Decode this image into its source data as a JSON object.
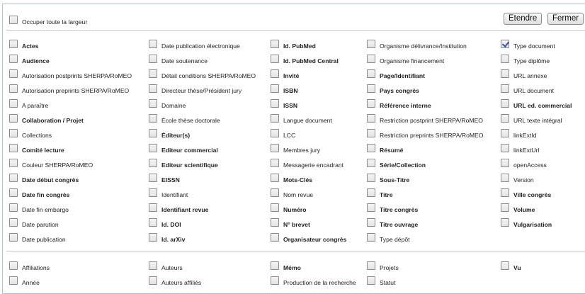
{
  "top": {
    "full_width_label": "Occuper toute la largeur",
    "expand_label": "Etendre",
    "close_label": "Fermer"
  },
  "fields": [
    [
      {
        "label": "Actes",
        "bold": true,
        "checked": false
      },
      {
        "label": "Audience",
        "bold": true,
        "checked": false
      },
      {
        "label": "Autorisation postprints SHERPA/RoMEO",
        "bold": false,
        "checked": false
      },
      {
        "label": "Autorisation preprints SHERPA/RoMEO",
        "bold": false,
        "checked": false
      },
      {
        "label": "A paraître",
        "bold": false,
        "checked": false
      },
      {
        "label": "Collaboration / Projet",
        "bold": true,
        "checked": false
      },
      {
        "label": "Collections",
        "bold": false,
        "checked": false
      },
      {
        "label": "Comité lecture",
        "bold": true,
        "checked": false
      },
      {
        "label": "Couleur SHERPA/RoMEO",
        "bold": false,
        "checked": false
      },
      {
        "label": "Date début congrès",
        "bold": true,
        "checked": false
      },
      {
        "label": "Date fin congrès",
        "bold": true,
        "checked": false
      },
      {
        "label": "Date fin embargo",
        "bold": false,
        "checked": false
      },
      {
        "label": "Date parution",
        "bold": false,
        "checked": false
      },
      {
        "label": "Date publication",
        "bold": false,
        "checked": false
      }
    ],
    [
      {
        "label": "Date publication électronique",
        "bold": false,
        "checked": false
      },
      {
        "label": "Date soutenance",
        "bold": false,
        "checked": false
      },
      {
        "label": "Détail conditions SHERPA/RoMEO",
        "bold": false,
        "checked": false
      },
      {
        "label": "Directeur thèse/Président jury",
        "bold": false,
        "checked": false
      },
      {
        "label": "Domaine",
        "bold": false,
        "checked": false
      },
      {
        "label": "École thèse doctorale",
        "bold": false,
        "checked": false
      },
      {
        "label": "Éditeur(s)",
        "bold": true,
        "checked": false
      },
      {
        "label": "Editeur commercial",
        "bold": true,
        "checked": false
      },
      {
        "label": "Editeur scientifique",
        "bold": true,
        "checked": false
      },
      {
        "label": "EISSN",
        "bold": true,
        "checked": false
      },
      {
        "label": "Identifiant",
        "bold": false,
        "checked": false
      },
      {
        "label": "Identifiant revue",
        "bold": true,
        "checked": false
      },
      {
        "label": "Id. DOI",
        "bold": true,
        "checked": false
      },
      {
        "label": "Id. arXiv",
        "bold": true,
        "checked": false
      }
    ],
    [
      {
        "label": "Id. PubMed",
        "bold": true,
        "checked": false
      },
      {
        "label": "Id. PubMed Central",
        "bold": true,
        "checked": false
      },
      {
        "label": "Invité",
        "bold": true,
        "checked": false
      },
      {
        "label": "ISBN",
        "bold": true,
        "checked": false
      },
      {
        "label": "ISSN",
        "bold": true,
        "checked": false
      },
      {
        "label": "Langue document",
        "bold": false,
        "checked": false
      },
      {
        "label": "LCC",
        "bold": false,
        "checked": false
      },
      {
        "label": "Membres jury",
        "bold": false,
        "checked": false
      },
      {
        "label": "Messagerie encadrant",
        "bold": false,
        "checked": false
      },
      {
        "label": "Mots-Clés",
        "bold": true,
        "checked": false
      },
      {
        "label": "Nom revue",
        "bold": false,
        "checked": false
      },
      {
        "label": "Numéro",
        "bold": true,
        "checked": false
      },
      {
        "label": "N° brevet",
        "bold": true,
        "checked": false
      },
      {
        "label": "Organisateur congrès",
        "bold": true,
        "checked": false
      }
    ],
    [
      {
        "label": "Organisme délivrance/Institution",
        "bold": false,
        "checked": false
      },
      {
        "label": "Organisme financement",
        "bold": false,
        "checked": false
      },
      {
        "label": "Page/Identifiant",
        "bold": true,
        "checked": false
      },
      {
        "label": "Pays congrès",
        "bold": true,
        "checked": false
      },
      {
        "label": "Référence interne",
        "bold": true,
        "checked": false
      },
      {
        "label": "Restriction postprint SHERPA/RoMEO",
        "bold": false,
        "checked": false
      },
      {
        "label": "Restriction preprints SHERPA/RoMEO",
        "bold": false,
        "checked": false
      },
      {
        "label": "Résumé",
        "bold": true,
        "checked": false
      },
      {
        "label": "Série/Collection",
        "bold": true,
        "checked": false
      },
      {
        "label": "Sous-Titre",
        "bold": true,
        "checked": false
      },
      {
        "label": "Titre",
        "bold": true,
        "checked": false
      },
      {
        "label": "Titre congrès",
        "bold": true,
        "checked": false
      },
      {
        "label": "Titre ouvrage",
        "bold": true,
        "checked": false
      },
      {
        "label": "Type dépôt",
        "bold": false,
        "checked": false
      }
    ],
    [
      {
        "label": "Type document",
        "bold": false,
        "checked": true
      },
      {
        "label": "Type diplôme",
        "bold": false,
        "checked": false
      },
      {
        "label": "URL annexe",
        "bold": false,
        "checked": false
      },
      {
        "label": "URL document",
        "bold": false,
        "checked": false
      },
      {
        "label": "URL ed. commercial",
        "bold": true,
        "checked": false
      },
      {
        "label": "URL texte intégral",
        "bold": false,
        "checked": false
      },
      {
        "label": "linkExtId",
        "bold": false,
        "checked": false
      },
      {
        "label": "linkExtUrl",
        "bold": false,
        "checked": false
      },
      {
        "label": "openAccess",
        "bold": false,
        "checked": false
      },
      {
        "label": "Version",
        "bold": false,
        "checked": false
      },
      {
        "label": "Ville congrès",
        "bold": true,
        "checked": false
      },
      {
        "label": "Volume",
        "bold": true,
        "checked": false
      },
      {
        "label": "Vulgarisation",
        "bold": true,
        "checked": false
      }
    ]
  ],
  "extra": [
    [
      {
        "label": "Affiliations",
        "bold": false,
        "checked": false
      },
      {
        "label": "Année",
        "bold": false,
        "checked": false
      }
    ],
    [
      {
        "label": "Auteurs",
        "bold": false,
        "checked": false
      },
      {
        "label": "Auteurs affiliés",
        "bold": false,
        "checked": false
      }
    ],
    [
      {
        "label": "Mémo",
        "bold": true,
        "checked": false
      },
      {
        "label": "Production de la recherche",
        "bold": false,
        "checked": false
      }
    ],
    [
      {
        "label": "Projets",
        "bold": false,
        "checked": false
      },
      {
        "label": "Statut",
        "bold": false,
        "checked": false
      }
    ],
    [
      {
        "label": "Vu",
        "bold": true,
        "checked": false
      }
    ]
  ]
}
